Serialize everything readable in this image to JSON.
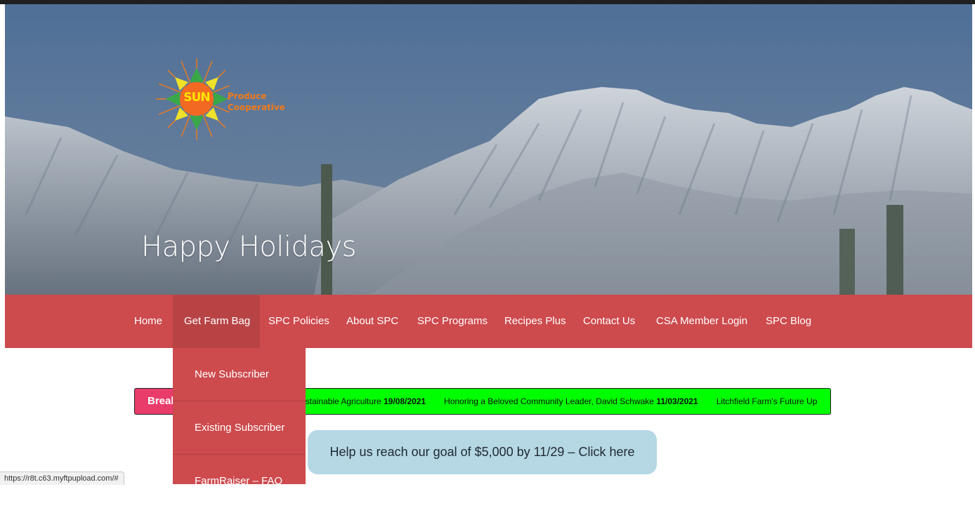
{
  "hero": {
    "title": "Happy Holidays",
    "logo": {
      "sun_text": "SUN",
      "line1": "Produce",
      "line2": "Cooperative"
    }
  },
  "nav": {
    "items": [
      {
        "label": "Home"
      },
      {
        "label": "Get Farm Bag",
        "active": true
      },
      {
        "label": "SPC Policies"
      },
      {
        "label": "About SPC"
      },
      {
        "label": "SPC Programs"
      },
      {
        "label": "Recipes Plus"
      },
      {
        "label": "Contact Us"
      },
      {
        "label": "CSA Member Login"
      },
      {
        "label": "SPC Blog"
      }
    ],
    "dropdown": [
      "New Subscriber",
      "Existing Subscriber",
      "FarmRaiser – FAQ"
    ]
  },
  "ticker": {
    "label": "Break",
    "items": [
      {
        "title": "ustainable Agriculture",
        "date": "19/08/2021"
      },
      {
        "title": "Honoring a Beloved Community Leader, David Schwake",
        "date": "11/03/2021"
      },
      {
        "title": "Litchfield Farm's Future Up",
        "date": ""
      }
    ]
  },
  "goal_button": "Help us reach our goal of $5,000 by 11/29 – Click here",
  "status_bar": {
    "url": "https://r8t.c63.myftpupload.com/#"
  },
  "colors": {
    "nav": "#cd4a4d",
    "nav_active": "#b84345",
    "ticker_label": "#e93c6b",
    "ticker_bg": "#00ff00",
    "goal_button": "#b6d7e4",
    "logo_sun": "#ffe500",
    "logo_text": "#f07a1a"
  },
  "icons": {
    "logo": "sun-produce-logo-icon"
  }
}
